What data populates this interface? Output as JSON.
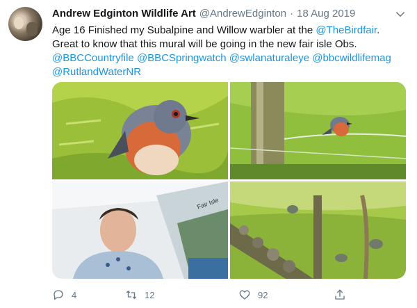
{
  "tweet": {
    "display_name": "Andrew Edginton Wildlife Art",
    "handle": "@AndrewEdginton",
    "separator": "·",
    "date": "18 Aug 2019",
    "text": {
      "line1_prefix": "Age 16 Finished my Subalpine and Willow warbler at the ",
      "line1_mention": "@TheBirdfair",
      "line1_suffix": ".",
      "line2": "Great to know that this mural will be going in the new fair isle Obs.",
      "line3": [
        "@BBCCountryfile",
        "@BBCSpringwatch",
        "@swlanaturaleye",
        "@bbcwildlifemag"
      ],
      "line4": "@RutlandWaterNR"
    },
    "media_overlay_text": "Fair Isle",
    "actions": {
      "reply": {
        "icon": "reply-icon",
        "count": "4"
      },
      "retweet": {
        "icon": "retweet-icon",
        "count": "12"
      },
      "like": {
        "icon": "heart-icon",
        "count": "92"
      },
      "share": {
        "icon": "share-icon"
      }
    }
  },
  "colors": {
    "text": "#14171a",
    "secondary": "#657786",
    "link": "#1b95e0"
  }
}
